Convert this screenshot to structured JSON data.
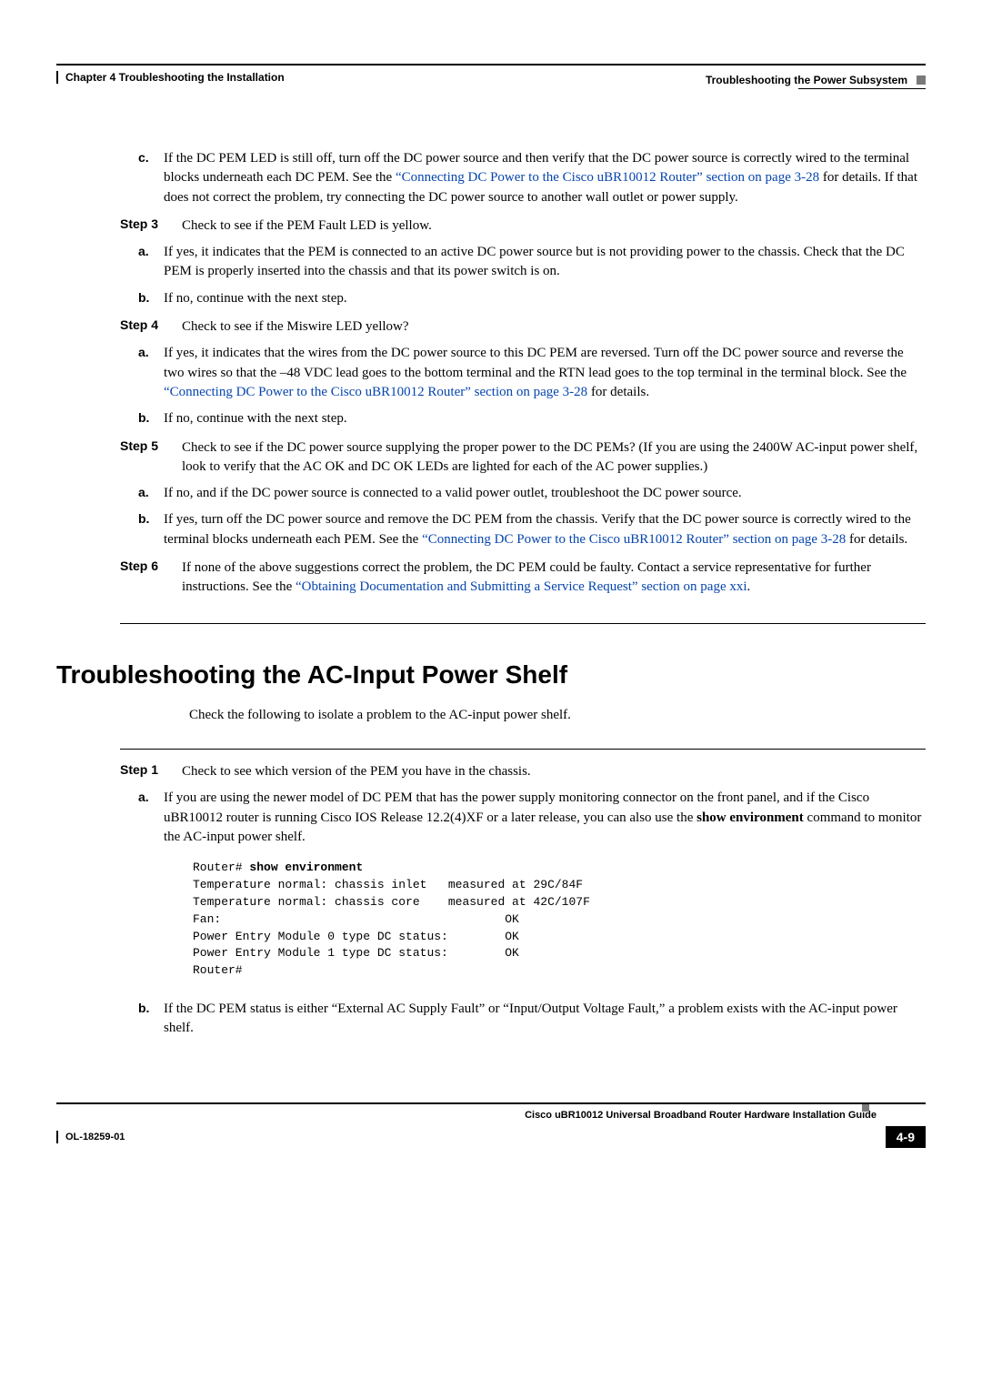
{
  "header": {
    "left": "Chapter 4      Troubleshooting the Installation",
    "right": "Troubleshooting the Power Subsystem"
  },
  "intro_c": {
    "letter": "c.",
    "pre": "If the DC PEM LED is still off, turn off the DC power source and then verify that the DC power source is correctly wired to the terminal blocks underneath each DC PEM. See the ",
    "link": "“Connecting DC Power to the Cisco uBR10012 Router” section on page 3-28",
    "post": " for details. If that does not correct the problem, try connecting the DC power source to another wall outlet or power supply."
  },
  "step3": {
    "label": "Step 3",
    "text": "Check to see if the PEM Fault LED is yellow.",
    "a": {
      "letter": "a.",
      "text": "If yes, it indicates that the PEM is connected to an active DC power source but is not providing power to the chassis. Check that the DC PEM is properly inserted into the chassis and that its power switch is on."
    },
    "b": {
      "letter": "b.",
      "text": "If no, continue with the next step."
    }
  },
  "step4": {
    "label": "Step 4",
    "text": "Check to see if the Miswire LED yellow?",
    "a": {
      "letter": "a.",
      "pre": "If yes, it indicates that the wires from the DC power source to this DC PEM are reversed. Turn off the DC power source and reverse the two wires so that the –48 VDC lead goes to the bottom terminal and the RTN lead goes to the top terminal in the terminal block. See the ",
      "link": "“Connecting DC Power to the Cisco uBR10012 Router” section on page 3-28",
      "post": " for details."
    },
    "b": {
      "letter": "b.",
      "text": "If no, continue with the next step."
    }
  },
  "step5": {
    "label": "Step 5",
    "text": "Check to see if the DC power source supplying the proper power to the DC PEMs? (If you are using the 2400W AC-input power shelf, look to verify that the AC OK and DC OK LEDs are lighted for each of the AC power supplies.)",
    "a": {
      "letter": "a.",
      "text": "If no, and if the DC power source is connected to a valid power outlet, troubleshoot the DC power source."
    },
    "b": {
      "letter": "b.",
      "pre": "If yes, turn off the DC power source and remove the DC PEM from the chassis. Verify that the DC power source is correctly wired to the terminal blocks underneath each PEM. See the ",
      "link": "“Connecting DC Power to the Cisco uBR10012 Router” section on page 3-28",
      "post": " for details."
    }
  },
  "step6": {
    "label": "Step 6",
    "pre": "If none of the above suggestions correct the problem, the DC PEM could be faulty. Contact a service representative for further instructions. See the ",
    "link": "“Obtaining Documentation and Submitting a Service Request” section on page xxi",
    "post": "."
  },
  "section_heading": "Troubleshooting the AC-Input Power Shelf",
  "section_intro": "Check the following to isolate a problem to the AC-input power shelf.",
  "sec_step1": {
    "label": "Step 1",
    "text": "Check to see which version of the PEM you have in the chassis.",
    "a": {
      "letter": "a.",
      "pre": "If you are using the newer model of DC PEM that has the power supply monitoring connector on the front panel, and if the Cisco uBR10012 router is running Cisco IOS Release 12.2(4)XF or a later release, you can also use the ",
      "cmd": "show environment",
      "post": " command to monitor the AC-input power shelf."
    },
    "code": {
      "prompt": "Router# ",
      "command": "show environment",
      "l1": "Temperature normal: chassis inlet   measured at 29C/84F",
      "l2": "Temperature normal: chassis core    measured at 42C/107F",
      "l3": "Fan:                                        OK",
      "l4": "Power Entry Module 0 type DC status:        OK",
      "l5": "Power Entry Module 1 type DC status:        OK",
      "l6": "Router#"
    },
    "b": {
      "letter": "b.",
      "text": "If the DC PEM status is either “External AC Supply Fault” or “Input/Output Voltage Fault,” a problem exists with the AC-input power shelf."
    }
  },
  "footer": {
    "guide": "Cisco uBR10012 Universal Broadband Router Hardware Installation Guide",
    "docnum": "OL-18259-01",
    "pagenum": "4-9"
  }
}
